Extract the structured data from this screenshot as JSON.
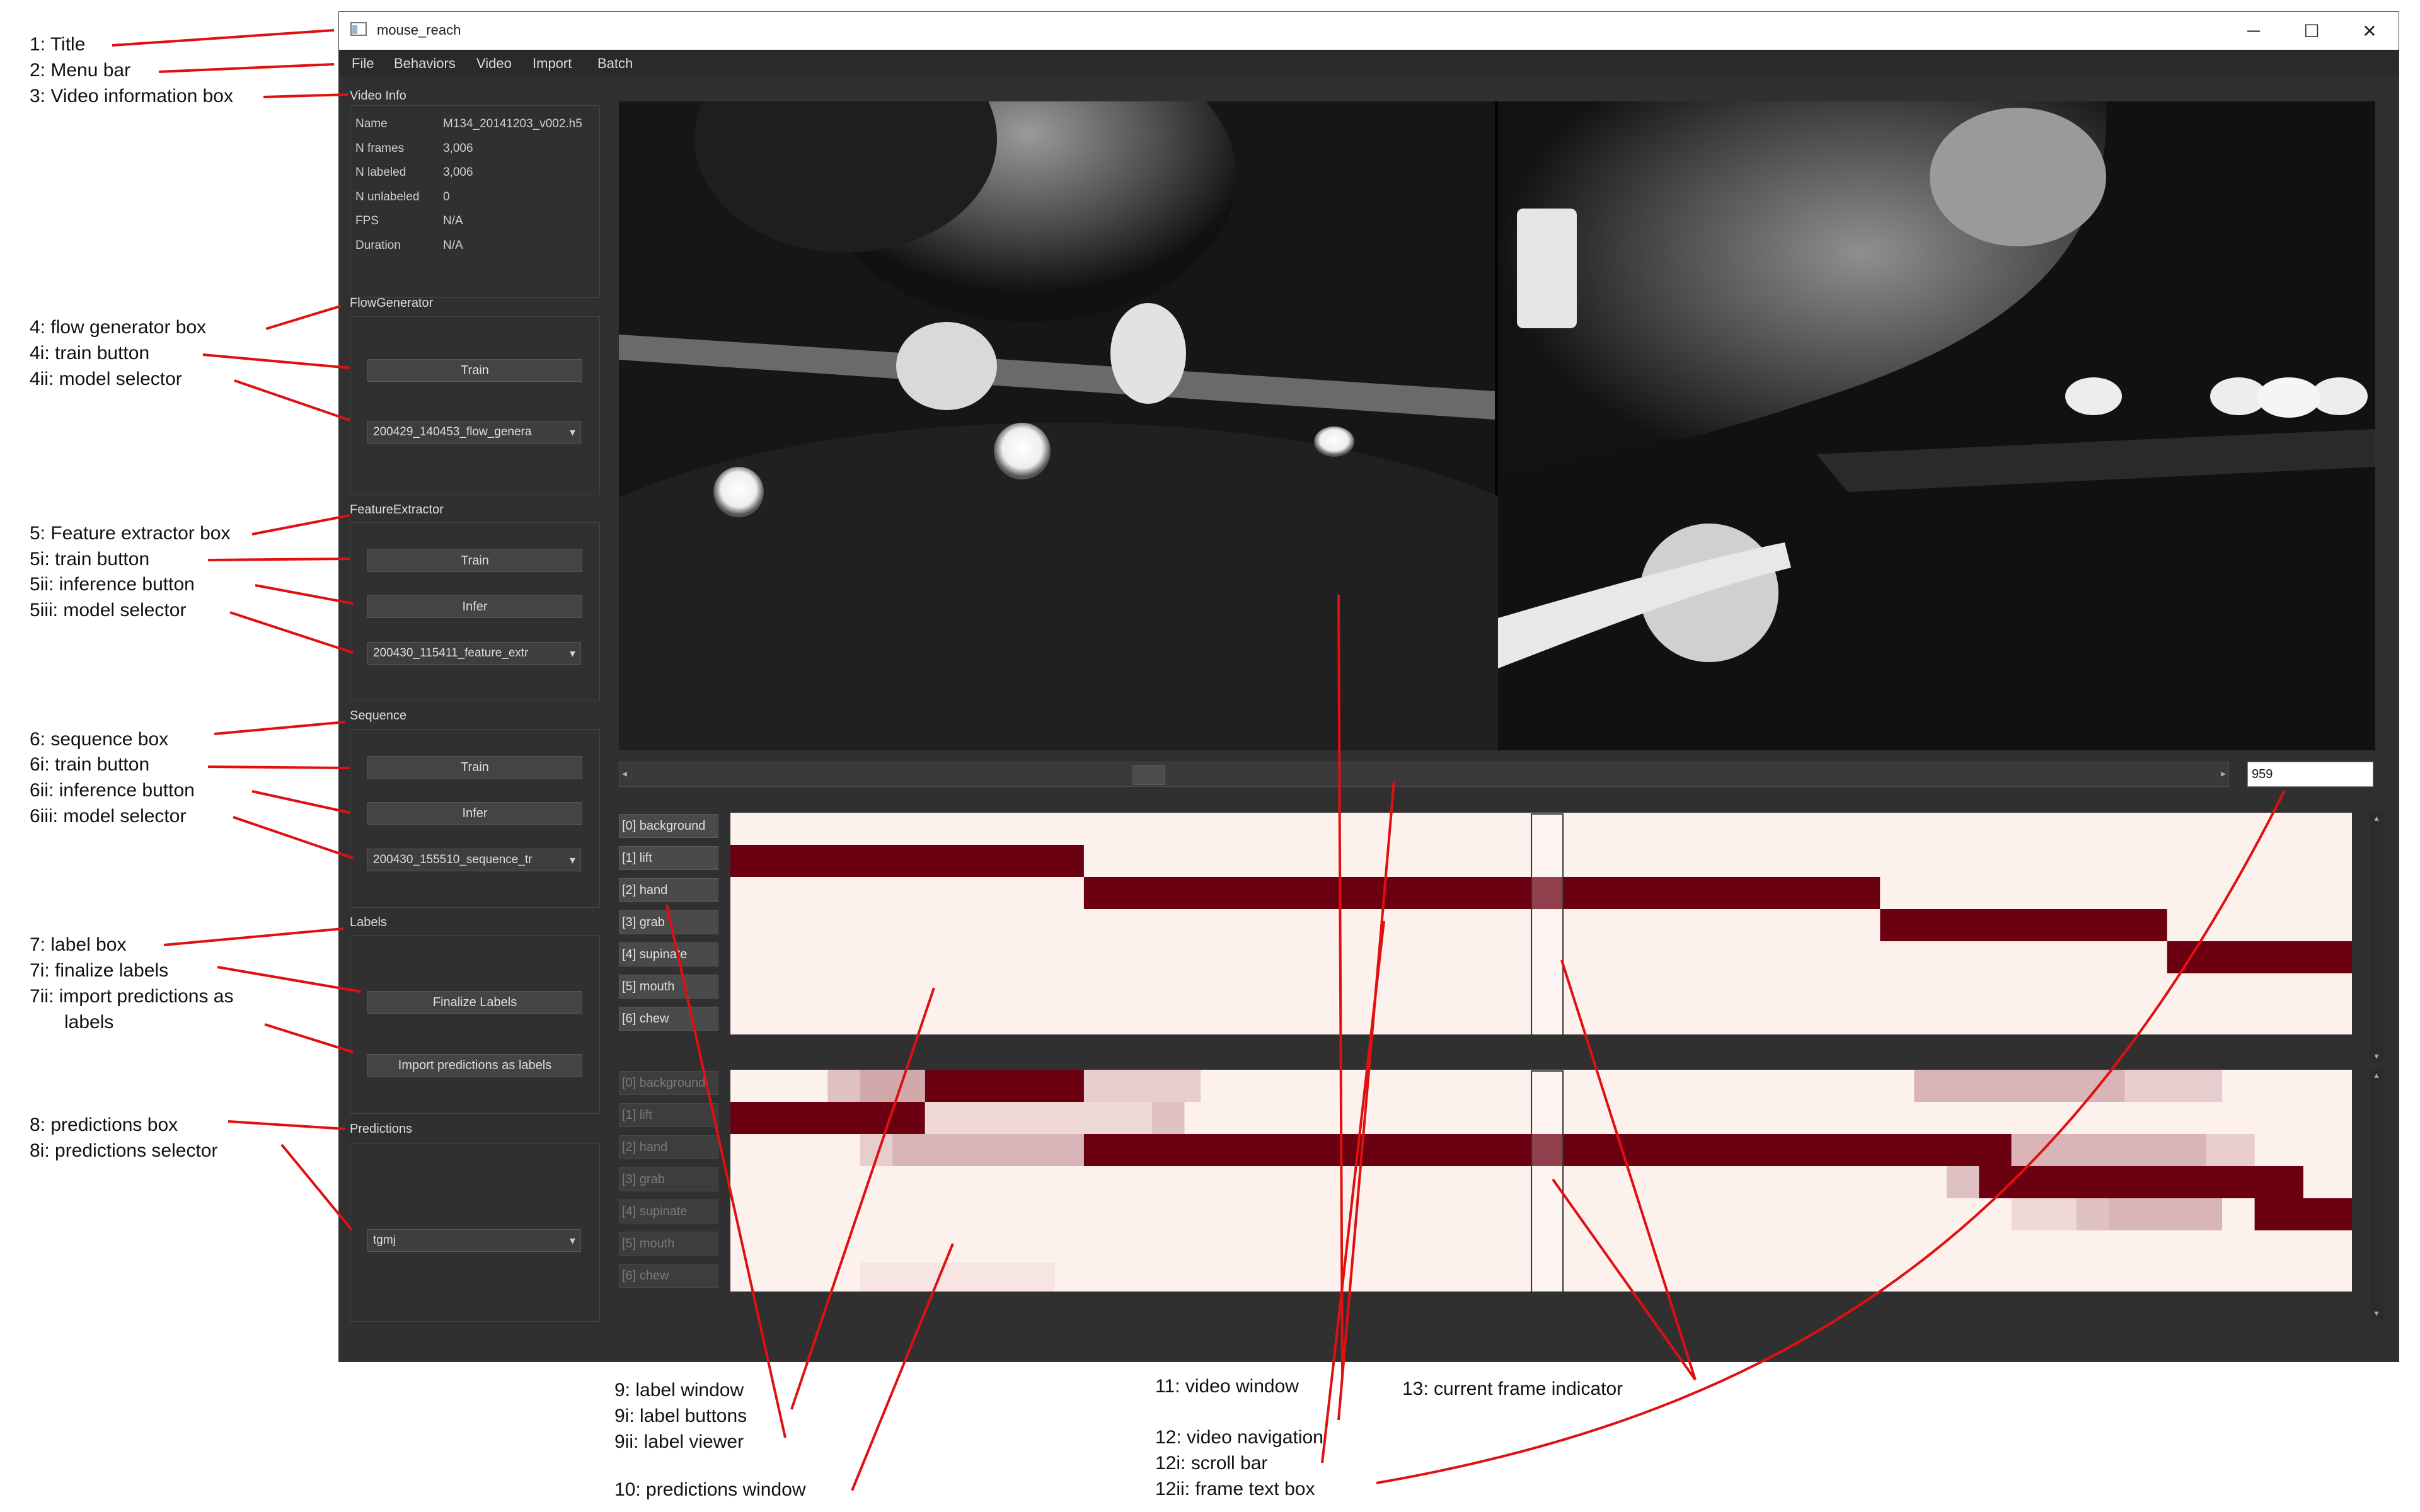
{
  "callouts": {
    "c1": "1: Title",
    "c2": "2: Menu bar",
    "c3": "3: Video information box",
    "c4": "4: flow generator box",
    "c4i": "4i: train button",
    "c4ii": "4ii: model selector",
    "c5": "5: Feature extractor box",
    "c5i": "5i: train button",
    "c5ii": "5ii: inference button",
    "c5iii": "5iii: model selector",
    "c6": "6: sequence box",
    "c6i": "6i: train button",
    "c6ii": "6ii: inference button",
    "c6iii": "6iii: model selector",
    "c7": "7: label box",
    "c7i": "7i: finalize labels",
    "c7ii_a": "7ii: import predictions as",
    "c7ii_b": "labels",
    "c8": "8: predictions box",
    "c8i": "8i: predictions selector",
    "c9": "9: label window",
    "c9i": "9i: label buttons",
    "c9ii": "9ii: label viewer",
    "c10": "10: predictions window",
    "c11": "11: video window",
    "c12": "12: video navigation",
    "c12i": "12i: scroll bar",
    "c12ii": "12ii: frame text box",
    "c13": "13: current frame indicator"
  },
  "window": {
    "title": "mouse_reach",
    "minimize": "─",
    "maximize": "☐",
    "close": "✕"
  },
  "menu": [
    "File",
    "Behaviors",
    "Video",
    "Import",
    "Batch"
  ],
  "video_info": {
    "title": "Video Info",
    "rows": [
      {
        "key": "Name",
        "value": "M134_20141203_v002.h5"
      },
      {
        "key": "N frames",
        "value": "3,006"
      },
      {
        "key": "N labeled",
        "value": "3,006"
      },
      {
        "key": "N unlabeled",
        "value": "0"
      },
      {
        "key": "FPS",
        "value": "N/A"
      },
      {
        "key": "Duration",
        "value": "N/A"
      }
    ]
  },
  "flow_generator": {
    "title": "FlowGenerator",
    "train": "Train",
    "model": "200429_140453_flow_genera"
  },
  "feature_extractor": {
    "title": "FeatureExtractor",
    "train": "Train",
    "infer": "Infer",
    "model": "200430_115411_feature_extr"
  },
  "sequence": {
    "title": "Sequence",
    "train": "Train",
    "infer": "Infer",
    "model": "200430_155510_sequence_tr"
  },
  "labels": {
    "title": "Labels",
    "finalize": "Finalize Labels",
    "import_predictions": "Import predictions as labels"
  },
  "predictions": {
    "title": "Predictions",
    "selected": "tgmj"
  },
  "frame": {
    "current": "959",
    "total": 3006
  },
  "behaviors": [
    "[0] background",
    "[1] lift",
    "[2] hand",
    "[3] grab",
    "[4] supinate",
    "[5] mouth",
    "[6] chew"
  ],
  "colors": {
    "label_on": "#6b0010",
    "label_off": "#fdf1ee",
    "panel": "#303030"
  },
  "label_segments": [
    {
      "row": 1,
      "from": 0.0,
      "to": 0.218
    },
    {
      "row": 2,
      "from": 0.218,
      "to": 0.709
    },
    {
      "row": 3,
      "from": 0.709,
      "to": 0.886
    },
    {
      "row": 4,
      "from": 0.886,
      "to": 1.0
    }
  ],
  "prediction_segments": [
    {
      "row": 0,
      "from": 0.06,
      "to": 0.08,
      "p": 0.2
    },
    {
      "row": 0,
      "from": 0.08,
      "to": 0.12,
      "p": 0.3
    },
    {
      "row": 0,
      "from": 0.12,
      "to": 0.218,
      "p": 1.0
    },
    {
      "row": 0,
      "from": 0.218,
      "to": 0.29,
      "p": 0.15
    },
    {
      "row": 0,
      "from": 0.73,
      "to": 0.86,
      "p": 0.25
    },
    {
      "row": 0,
      "from": 0.86,
      "to": 0.92,
      "p": 0.15
    },
    {
      "row": 1,
      "from": 0.0,
      "to": 0.12,
      "p": 1.0
    },
    {
      "row": 1,
      "from": 0.12,
      "to": 0.26,
      "p": 0.1
    },
    {
      "row": 1,
      "from": 0.26,
      "to": 0.28,
      "p": 0.2
    },
    {
      "row": 2,
      "from": 0.08,
      "to": 0.1,
      "p": 0.15
    },
    {
      "row": 2,
      "from": 0.1,
      "to": 0.218,
      "p": 0.25
    },
    {
      "row": 2,
      "from": 0.218,
      "to": 0.79,
      "p": 1.0
    },
    {
      "row": 2,
      "from": 0.79,
      "to": 0.91,
      "p": 0.25
    },
    {
      "row": 2,
      "from": 0.91,
      "to": 0.94,
      "p": 0.15
    },
    {
      "row": 3,
      "from": 0.75,
      "to": 0.77,
      "p": 0.2
    },
    {
      "row": 3,
      "from": 0.77,
      "to": 0.97,
      "p": 1.0
    },
    {
      "row": 4,
      "from": 0.79,
      "to": 0.83,
      "p": 0.1
    },
    {
      "row": 4,
      "from": 0.83,
      "to": 0.85,
      "p": 0.2
    },
    {
      "row": 4,
      "from": 0.85,
      "to": 0.92,
      "p": 0.25
    },
    {
      "row": 4,
      "from": 0.94,
      "to": 1.0,
      "p": 1.0
    },
    {
      "row": 6,
      "from": 0.08,
      "to": 0.2,
      "p": 0.05
    }
  ]
}
